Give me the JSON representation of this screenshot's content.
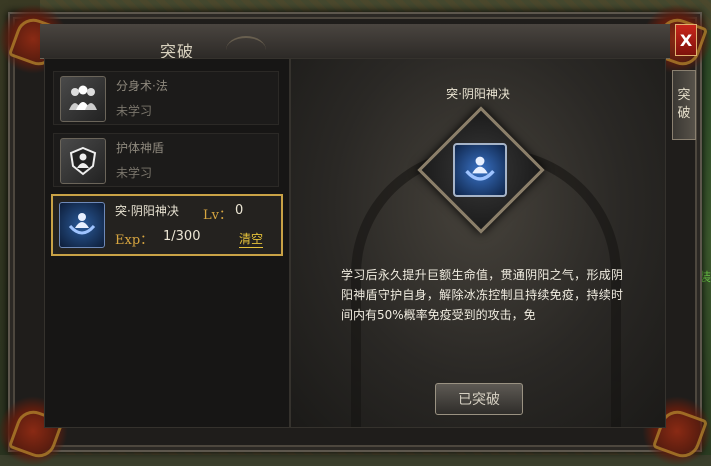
{
  "window": {
    "title": "突破",
    "close_label": "X",
    "side_tab_chars": [
      "突",
      "破"
    ]
  },
  "skills": [
    {
      "name": "分身术·法",
      "status": "未学习",
      "icon": "clone-figures-icon",
      "learned": false
    },
    {
      "name": "护体神盾",
      "status": "未学习",
      "icon": "shield-icon",
      "learned": false
    },
    {
      "name": "突·阴阳神决",
      "lv_label": "Lv：",
      "lv": "0",
      "exp_label": "Exp：",
      "exp": "1/300",
      "clear_label": "清空",
      "icon": "yinyang-shield-icon",
      "learned": true
    }
  ],
  "detail": {
    "title": "突·阴阳神决",
    "description": "学习后永久提升巨额生命值，贯通阴阳之气，形成阴阳神盾守护自身，解除冰冻控制且持续免疫，持续时间内有50%概率免疫受到的攻击，免",
    "button_label": "已突破"
  },
  "colors": {
    "accent_gold": "#c9a246",
    "close_red": "#c8261b"
  }
}
